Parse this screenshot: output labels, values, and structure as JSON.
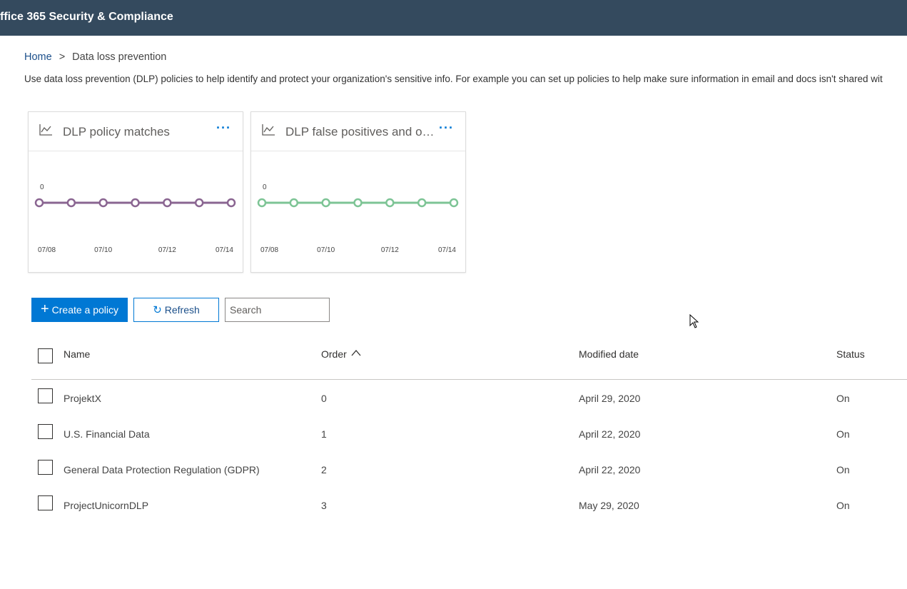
{
  "app": {
    "title": "ffice 365 Security & Compliance"
  },
  "breadcrumb": {
    "home": "Home",
    "separator": ">",
    "current": "Data loss prevention"
  },
  "description": "Use data loss prevention (DLP) policies to help identify and protect your organization's sensitive info. For example you can set up policies to help make sure information in email and docs isn't shared wit",
  "cards": [
    {
      "title": "DLP policy matches",
      "more": "···",
      "color": "#8a6591",
      "chart_data": {
        "type": "line",
        "x": [
          "07/08",
          "07/09",
          "07/10",
          "07/11",
          "07/12",
          "07/13",
          "07/14"
        ],
        "values": [
          0,
          0,
          0,
          0,
          0,
          0,
          0
        ],
        "y_label_shown": "0",
        "x_ticks": [
          "07/08",
          "07/10",
          "07/12",
          "07/14"
        ]
      }
    },
    {
      "title": "DLP false positives and ov...",
      "more": "···",
      "color": "#7dc495",
      "chart_data": {
        "type": "line",
        "x": [
          "07/08",
          "07/09",
          "07/10",
          "07/11",
          "07/12",
          "07/13",
          "07/14"
        ],
        "values": [
          0,
          0,
          0,
          0,
          0,
          0,
          0
        ],
        "y_label_shown": "0",
        "x_ticks": [
          "07/08",
          "07/10",
          "07/12",
          "07/14"
        ]
      }
    }
  ],
  "toolbar": {
    "create_label": "Create a policy",
    "refresh_label": "Refresh",
    "search_placeholder": "Search"
  },
  "table": {
    "headers": {
      "name": "Name",
      "order": "Order",
      "modified": "Modified date",
      "status": "Status"
    },
    "rows": [
      {
        "name": "ProjektX",
        "order": "0",
        "modified": "April 29, 2020",
        "status": "On"
      },
      {
        "name": "U.S. Financial Data",
        "order": "1",
        "modified": "April 22, 2020",
        "status": "On"
      },
      {
        "name": "General Data Protection Regulation (GDPR)",
        "order": "2",
        "modified": "April 22, 2020",
        "status": "On"
      },
      {
        "name": "ProjectUnicornDLP",
        "order": "3",
        "modified": "May 29, 2020",
        "status": "On"
      }
    ]
  },
  "colors": {
    "topbar": "#344a5e",
    "accent": "#0078d4"
  }
}
